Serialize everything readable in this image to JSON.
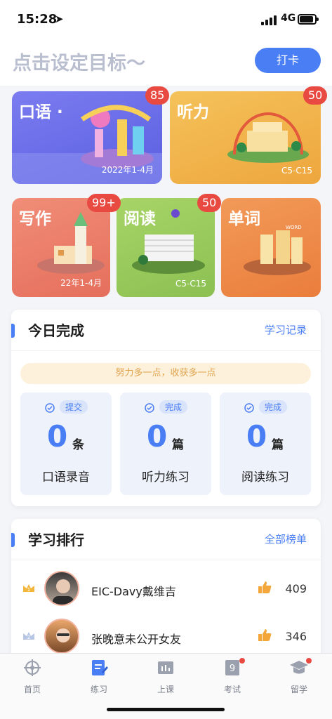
{
  "status_bar": {
    "time": "15:28",
    "network": "4G"
  },
  "header": {
    "goal_title": "点击设定目标～",
    "checkin_label": "打卡"
  },
  "tiles": {
    "speaking": {
      "title": "口语 ·",
      "subtitle": "2022年1-4月",
      "badge": "85",
      "color": "#6c6de6"
    },
    "listening": {
      "title": "听力",
      "subtitle": "C5-C15",
      "badge": "50",
      "color": "#f2b548"
    },
    "writing": {
      "title": "写作",
      "subtitle": "22年1-4月",
      "badge": "99+",
      "color": "#ea7b66"
    },
    "reading": {
      "title": "阅读",
      "subtitle": "C5-C15",
      "badge": "50",
      "color": "#9acb5c"
    },
    "vocabulary": {
      "title": "单词",
      "subtitle": "",
      "badge": "",
      "color": "#ee8a4a"
    }
  },
  "today": {
    "title": "今日完成",
    "link": "学习记录",
    "motto": "努力多一点，收获多一点",
    "stats": [
      {
        "pill": "提交",
        "value": "0",
        "unit": "条",
        "label": "口语录音"
      },
      {
        "pill": "完成",
        "value": "0",
        "unit": "篇",
        "label": "听力练习"
      },
      {
        "pill": "完成",
        "value": "0",
        "unit": "篇",
        "label": "阅读练习"
      }
    ]
  },
  "ranking": {
    "title": "学习排行",
    "link": "全部榜单",
    "rows": [
      {
        "rank": "1",
        "name": "EIC-Davy戴维吉",
        "score": "409"
      },
      {
        "rank": "2",
        "name": "张晚意未公开女友",
        "score": "346"
      }
    ]
  },
  "tabbar": {
    "items": [
      {
        "label": "首页",
        "icon": "helm-icon"
      },
      {
        "label": "练习",
        "icon": "practice-icon"
      },
      {
        "label": "上课",
        "icon": "class-icon"
      },
      {
        "label": "考试",
        "icon": "exam-icon"
      },
      {
        "label": "留学",
        "icon": "study-abroad-icon"
      }
    ],
    "accent": "#4a7ef5"
  }
}
